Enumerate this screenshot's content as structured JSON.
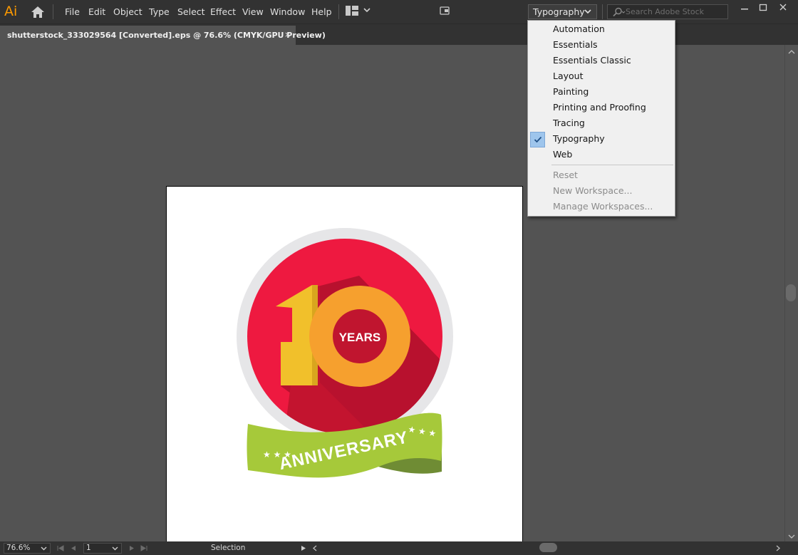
{
  "app": {
    "logo_text": "Ai",
    "menus": [
      "File",
      "Edit",
      "Object",
      "Type",
      "Select",
      "Effect",
      "View",
      "Window",
      "Help"
    ]
  },
  "workspace": {
    "current": "Typography",
    "search_placeholder": "Search Adobe Stock"
  },
  "document": {
    "tab_title": "shutterstock_333029564 [Converted].eps @ 76.6% (CMYK/GPU Preview)",
    "close_glyph": "×"
  },
  "workspace_menu": {
    "workspaces": [
      "Automation",
      "Essentials",
      "Essentials Classic",
      "Layout",
      "Painting",
      "Printing and Proofing",
      "Tracing",
      "Typography",
      "Web"
    ],
    "checked": "Typography",
    "actions": [
      "Reset",
      "New Workspace...",
      "Manage Workspaces..."
    ]
  },
  "artwork": {
    "number": "10",
    "badge_text": "YEARS",
    "ribbon_text": "ANNIVERSARY",
    "colors": {
      "outer_ring": "#e6e6e8",
      "red_circle": "#ee1940",
      "shadow": "#b8112e",
      "one": "#f1c02b",
      "zero": "#f6a02e",
      "inner_dot": "#c0152f",
      "ribbon": "#a6c93a",
      "ribbon_dark": "#6f8c34"
    }
  },
  "status": {
    "zoom": "76.6%",
    "artboard_number": "1",
    "tool": "Selection"
  }
}
